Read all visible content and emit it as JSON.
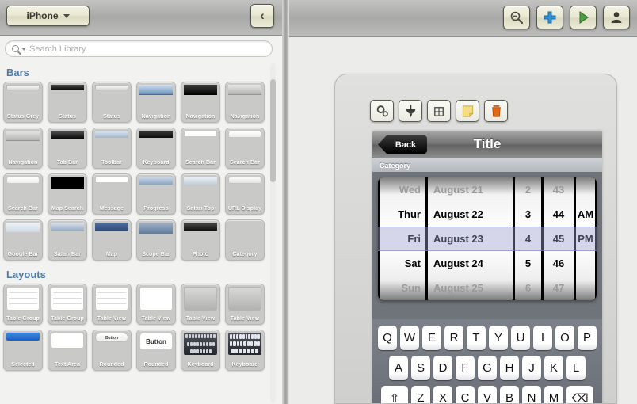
{
  "library": {
    "device_select": {
      "label": "iPhone",
      "caret_icon": "chevron-down-icon"
    },
    "collapse_button": {
      "icon": "chevron-left-icon",
      "glyph": "‹"
    },
    "search": {
      "placeholder": "Search Library",
      "icon": "search-icon"
    },
    "groups": [
      {
        "title": "Bars",
        "items": [
          {
            "label": "Status Grey",
            "thumb": "t-statusgrey"
          },
          {
            "label": "Status",
            "thumb": "t-statusblack"
          },
          {
            "label": "Status",
            "thumb": "t-statusgrey"
          },
          {
            "label": "Navigation",
            "thumb": "t-navblue"
          },
          {
            "label": "Navigation",
            "thumb": "t-navblack"
          },
          {
            "label": "Navigation",
            "thumb": "t-navgrey"
          },
          {
            "label": "Navigation",
            "thumb": "t-navgrey"
          },
          {
            "label": "Tab Bar",
            "thumb": "t-tabbar"
          },
          {
            "label": "Toolbar",
            "thumb": "t-toolbar"
          },
          {
            "label": "Keyboard",
            "thumb": "t-keyboard"
          },
          {
            "label": "Search Bar",
            "thumb": "t-white"
          },
          {
            "label": "Search Bar",
            "thumb": "t-searchwhite"
          },
          {
            "label": "Search Bar",
            "thumb": "t-searchwhite"
          },
          {
            "label": "Map Search",
            "thumb": "t-mapsearch"
          },
          {
            "label": "Message",
            "thumb": "t-white"
          },
          {
            "label": "Progress",
            "thumb": "t-progress"
          },
          {
            "label": "Safari Top",
            "thumb": "t-safaritop"
          },
          {
            "label": "URL Display",
            "thumb": "t-urldisp"
          },
          {
            "label": "Google Bar",
            "thumb": "t-googlebar"
          },
          {
            "label": "Safari Bar",
            "thumb": "t-safaribar"
          },
          {
            "label": "Map",
            "thumb": "t-map"
          },
          {
            "label": "Scope Bar",
            "thumb": "t-scopebar"
          },
          {
            "label": "Photo",
            "thumb": "t-photo"
          },
          {
            "label": "Category",
            "thumb": "t-none"
          }
        ]
      },
      {
        "title": "Layouts",
        "items": [
          {
            "label": "Table Group",
            "thumb": "t-tablegroup"
          },
          {
            "label": "Table Group",
            "thumb": "t-tablegroup"
          },
          {
            "label": "Table View",
            "thumb": "t-tableview"
          },
          {
            "label": "Table View",
            "thumb": "t-tableviewplain"
          },
          {
            "label": "Table View",
            "thumb": "t-tableviewgrad"
          },
          {
            "label": "Table View",
            "thumb": "t-tableviewgrad"
          },
          {
            "label": "Selected",
            "thumb": "t-selected"
          },
          {
            "label": "Text Area",
            "thumb": "t-textarea"
          },
          {
            "label": "Rounded",
            "thumb": "t-roundbtn",
            "inner_text": "Button"
          },
          {
            "label": "Rounded",
            "thumb": "t-roundbtn2",
            "inner_text": "Button"
          },
          {
            "label": "Keyboard",
            "thumb": "t-kbfull"
          },
          {
            "label": "Keyboard",
            "thumb": "t-kbfull t-kbfull2"
          }
        ]
      }
    ]
  },
  "canvas": {
    "toolbar": [
      {
        "name": "zoom-out-button",
        "icon": "zoom-out-icon"
      },
      {
        "name": "add-button",
        "icon": "plus-icon"
      },
      {
        "name": "play-button",
        "icon": "play-icon"
      },
      {
        "name": "person-button",
        "icon": "person-icon"
      }
    ],
    "mockup_toolbar": [
      {
        "name": "settings-button",
        "icon": "gears-icon"
      },
      {
        "name": "fill-button",
        "icon": "paint-bucket-icon"
      },
      {
        "name": "grid-button",
        "icon": "grid-icon"
      },
      {
        "name": "note-button",
        "icon": "sticky-note-icon"
      },
      {
        "name": "delete-button",
        "icon": "trash-icon"
      }
    ]
  },
  "mockup": {
    "nav_bar": {
      "back_label": "Back",
      "title": "Title"
    },
    "category_bar": {
      "label": "Category"
    },
    "date_picker": {
      "selected_index": 2,
      "columns": {
        "day": [
          "Wed",
          "Thur",
          "Fri",
          "Sat",
          "Sun"
        ],
        "date": [
          "August 21",
          "August 22",
          "August 23",
          "August 24",
          "August 25"
        ],
        "hour": [
          "2",
          "3",
          "4",
          "5",
          "6"
        ],
        "minute": [
          "43",
          "44",
          "45",
          "46",
          "47"
        ],
        "ampm": [
          "",
          "AM",
          "PM",
          "",
          ""
        ]
      }
    },
    "keyboard": {
      "rows": [
        [
          "Q",
          "W",
          "E",
          "R",
          "T",
          "Y",
          "U",
          "I",
          "O",
          "P"
        ],
        [
          "A",
          "S",
          "D",
          "F",
          "G",
          "H",
          "J",
          "K",
          "L"
        ],
        [
          "⇧",
          "Z",
          "X",
          "C",
          "V",
          "B",
          "N",
          "M",
          "⌫"
        ]
      ]
    }
  },
  "colors": {
    "chrome": "#a9a9a7",
    "panel_bg": "#f2f2f0",
    "group_title": "#4e7ca8",
    "cream_button": "#e9e8d2",
    "accent_blue": "#3b8ae0",
    "trash_orange": "#e06a1a",
    "picker_highlight": "#9a9ecd"
  }
}
